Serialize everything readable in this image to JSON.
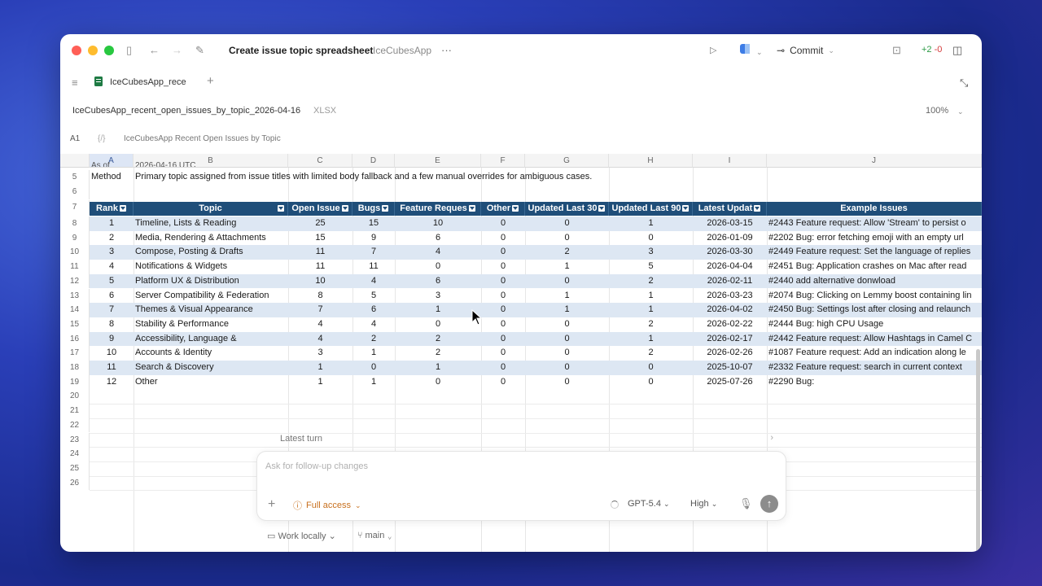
{
  "window": {
    "title": "Create issue topic spreadsheet",
    "project": "IceCubesApp",
    "more": "···",
    "commit_label": "Commit",
    "diff_plus": "+2",
    "diff_minus": "-0"
  },
  "tabs": [
    {
      "label": "IceCubesApp_rece"
    }
  ],
  "file": {
    "name": "IceCubesApp_recent_open_issues_by_topic_2026-04-16",
    "type": "XLSX",
    "zoom": "100%"
  },
  "formula_bar": {
    "cell_ref": "A1",
    "fx": "{/}",
    "value": "IceCubesApp Recent Open Issues by Topic"
  },
  "columns": [
    "A",
    "B",
    "C",
    "D",
    "E",
    "F",
    "G",
    "H",
    "I",
    "J"
  ],
  "partial_row": {
    "a": "As of",
    "b": "2026-04-16 UTC"
  },
  "method_row": {
    "num": "5",
    "label": "Method",
    "text": "Primary topic assigned from issue titles with limited body fallback and a few manual overrides for ambiguous cases."
  },
  "table_header": [
    "Rank",
    "Topic",
    "Open Issue",
    "Bugs",
    "Feature Reques",
    "Other",
    "Updated Last 30",
    "Updated Last 90",
    "Latest Updat",
    "Example Issues"
  ],
  "rows": [
    {
      "n": "8",
      "rank": "1",
      "topic": "Timeline, Lists & Reading",
      "open": "25",
      "bugs": "15",
      "feat": "10",
      "other": "0",
      "u30": "0",
      "u90": "1",
      "latest": "2026-03-15",
      "example": "#2443 Feature request: Allow 'Stream' to persist o"
    },
    {
      "n": "9",
      "rank": "2",
      "topic": "Media, Rendering & Attachments",
      "open": "15",
      "bugs": "9",
      "feat": "6",
      "other": "0",
      "u30": "0",
      "u90": "0",
      "latest": "2026-01-09",
      "example": "#2202 Bug: error fetching emoji with an empty url"
    },
    {
      "n": "10",
      "rank": "3",
      "topic": "Compose, Posting & Drafts",
      "open": "11",
      "bugs": "7",
      "feat": "4",
      "other": "0",
      "u30": "2",
      "u90": "3",
      "latest": "2026-03-30",
      "example": "#2449 Feature request: Set the language of replies"
    },
    {
      "n": "11",
      "rank": "4",
      "topic": "Notifications & Widgets",
      "open": "11",
      "bugs": "11",
      "feat": "0",
      "other": "0",
      "u30": "1",
      "u90": "5",
      "latest": "2026-04-04",
      "example": "#2451 Bug: Application crashes on Mac after read"
    },
    {
      "n": "12",
      "rank": "5",
      "topic": "Platform UX & Distribution",
      "open": "10",
      "bugs": "4",
      "feat": "6",
      "other": "0",
      "u30": "0",
      "u90": "2",
      "latest": "2026-02-11",
      "example": "#2440 add alternative donwload"
    },
    {
      "n": "13",
      "rank": "6",
      "topic": "Server Compatibility & Federation",
      "open": "8",
      "bugs": "5",
      "feat": "3",
      "other": "0",
      "u30": "1",
      "u90": "1",
      "latest": "2026-03-23",
      "example": "#2074 Bug: Clicking on Lemmy boost containing lin"
    },
    {
      "n": "14",
      "rank": "7",
      "topic": "Themes & Visual Appearance",
      "open": "7",
      "bugs": "6",
      "feat": "1",
      "other": "0",
      "u30": "1",
      "u90": "1",
      "latest": "2026-04-02",
      "example": "#2450 Bug: Settings lost after closing and relaunch"
    },
    {
      "n": "15",
      "rank": "8",
      "topic": "Stability & Performance",
      "open": "4",
      "bugs": "4",
      "feat": "0",
      "other": "0",
      "u30": "0",
      "u90": "2",
      "latest": "2026-02-22",
      "example": "#2444 Bug: high CPU Usage"
    },
    {
      "n": "16",
      "rank": "9",
      "topic": "Accessibility, Language &",
      "open": "4",
      "bugs": "2",
      "feat": "2",
      "other": "0",
      "u30": "0",
      "u90": "1",
      "latest": "2026-02-17",
      "example": "#2442 Feature request: Allow Hashtags in Camel C"
    },
    {
      "n": "17",
      "rank": "10",
      "topic": "Accounts & Identity",
      "open": "3",
      "bugs": "1",
      "feat": "2",
      "other": "0",
      "u30": "0",
      "u90": "2",
      "latest": "2026-02-26",
      "example": "#1087 Feature request: Add an indication along le"
    },
    {
      "n": "18",
      "rank": "11",
      "topic": "Search & Discovery",
      "open": "1",
      "bugs": "0",
      "feat": "1",
      "other": "0",
      "u30": "0",
      "u90": "0",
      "latest": "2025-10-07",
      "example": "#2332 Feature request: search in current context"
    },
    {
      "n": "19",
      "rank": "12",
      "topic": "Other",
      "open": "1",
      "bugs": "1",
      "feat": "0",
      "other": "0",
      "u30": "0",
      "u90": "0",
      "latest": "2025-07-26",
      "example": "#2290 Bug:"
    }
  ],
  "empty_rows": [
    "20",
    "21",
    "22",
    "23",
    "24",
    "25",
    "26"
  ],
  "composer": {
    "latest_turn": "Latest turn",
    "placeholder": "Ask for follow-up changes",
    "access": "Full access",
    "model": "GPT-5.4",
    "effort": "High"
  },
  "footer": {
    "work": "Work locally",
    "branch": "main"
  }
}
